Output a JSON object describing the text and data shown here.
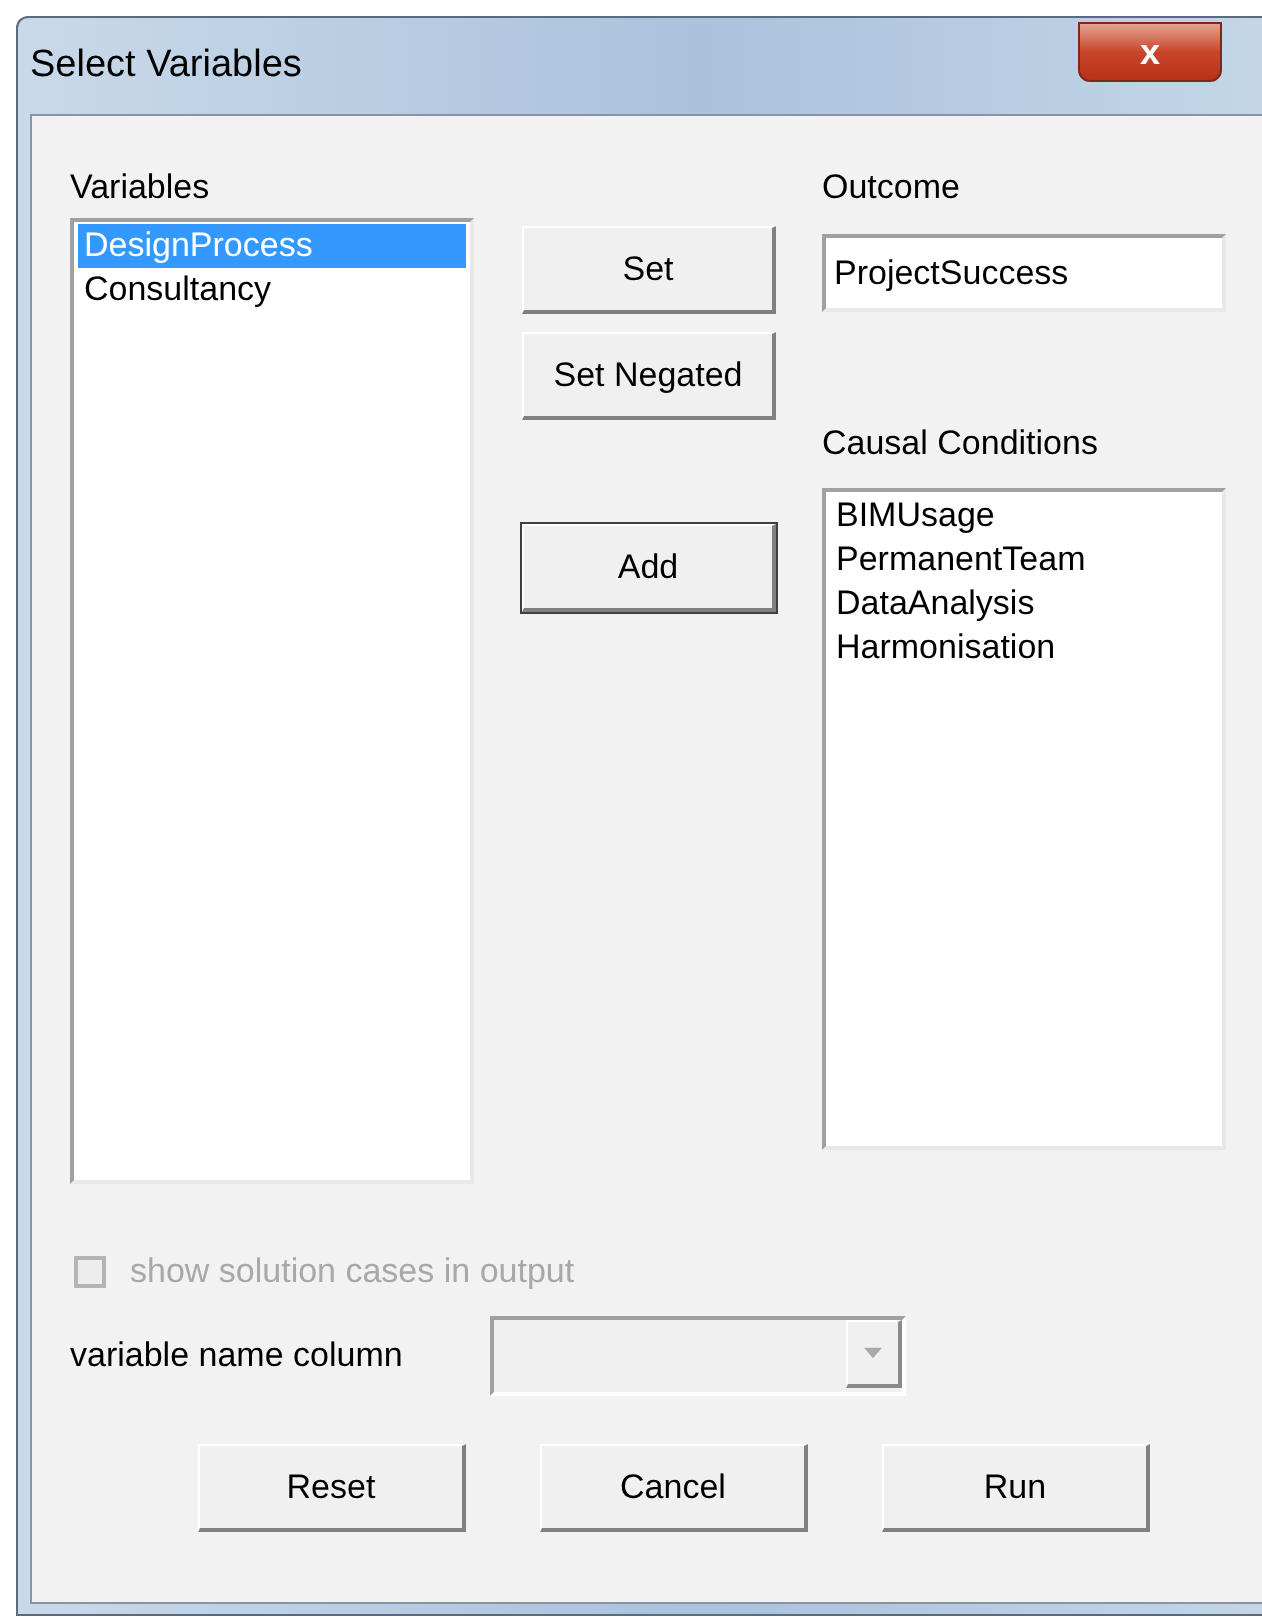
{
  "window": {
    "title": "Select Variables",
    "close_label": "x"
  },
  "variables": {
    "label": "Variables",
    "items": [
      {
        "label": "DesignProcess",
        "selected": true
      },
      {
        "label": "Consultancy",
        "selected": false
      }
    ]
  },
  "actions": [
    {
      "label": "Set",
      "focused": false
    },
    {
      "label": "Set Negated",
      "focused": false
    },
    {
      "label": "Add",
      "focused": true
    }
  ],
  "outcome": {
    "label": "Outcome",
    "value": "ProjectSuccess"
  },
  "causal_conditions": {
    "label": "Causal Conditions",
    "items": [
      {
        "label": "BIMUsage",
        "selected": false
      },
      {
        "label": "PermanentTeam",
        "selected": false
      },
      {
        "label": "DataAnalysis",
        "selected": false
      },
      {
        "label": "Harmonisation",
        "selected": false
      }
    ]
  },
  "show_solution_cases": {
    "label": "show solution cases in output",
    "checked": false,
    "disabled": true
  },
  "variable_name_column": {
    "label": "variable name column",
    "disabled": true
  },
  "buttons": [
    "Reset",
    "Cancel",
    "Run"
  ]
}
